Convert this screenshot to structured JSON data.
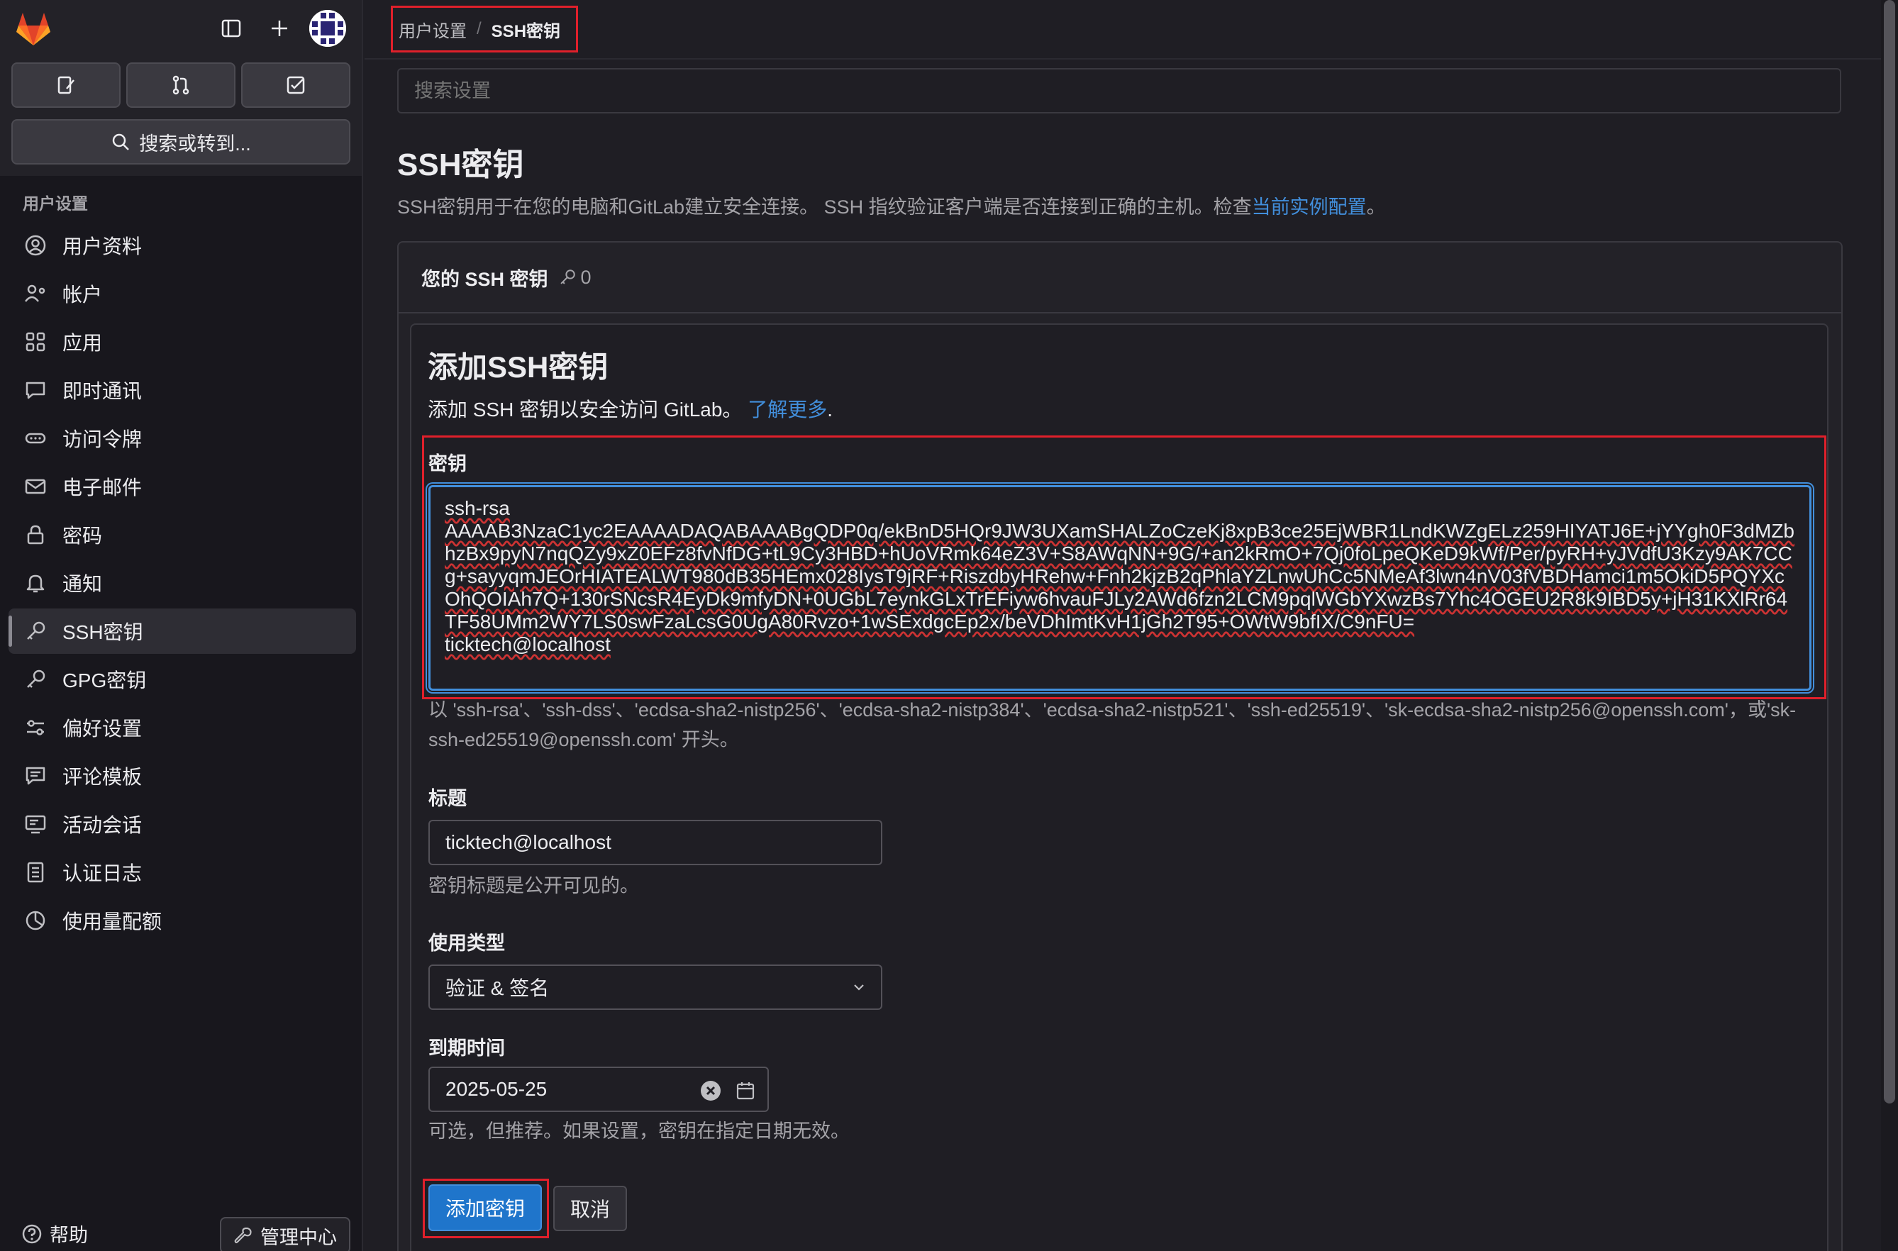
{
  "sidebar": {
    "search_label": "搜索或转到...",
    "section_title": "用户设置",
    "items": [
      {
        "label": "用户资料",
        "icon": "user-icon"
      },
      {
        "label": "帐户",
        "icon": "account-icon"
      },
      {
        "label": "应用",
        "icon": "apps-icon"
      },
      {
        "label": "即时通讯",
        "icon": "chat-icon"
      },
      {
        "label": "访问令牌",
        "icon": "token-icon"
      },
      {
        "label": "电子邮件",
        "icon": "mail-icon"
      },
      {
        "label": "密码",
        "icon": "lock-icon"
      },
      {
        "label": "通知",
        "icon": "bell-icon"
      },
      {
        "label": "SSH密钥",
        "icon": "key-icon",
        "active": true
      },
      {
        "label": "GPG密钥",
        "icon": "key-icon"
      },
      {
        "label": "偏好设置",
        "icon": "preferences-icon"
      },
      {
        "label": "评论模板",
        "icon": "comment-template-icon"
      },
      {
        "label": "活动会话",
        "icon": "monitor-icon"
      },
      {
        "label": "认证日志",
        "icon": "log-icon"
      },
      {
        "label": "使用量配额",
        "icon": "quota-icon"
      }
    ],
    "help_label": "帮助",
    "admin_label": "管理中心"
  },
  "breadcrumb": {
    "parent": "用户设置",
    "separator": "/",
    "current": "SSH密钥"
  },
  "search": {
    "placeholder": "搜索设置"
  },
  "page": {
    "title": "SSH密钥",
    "description": "SSH密钥用于在您的电脑和GitLab建立安全连接。 SSH 指纹验证客户端是否连接到正确的主机。检查",
    "description_link": "当前实例配置",
    "description_end": "。"
  },
  "keys_card": {
    "title": "您的 SSH 密钥",
    "count": "0"
  },
  "form": {
    "title": "添加SSH密钥",
    "description": "添加 SSH 密钥以安全访问 GitLab。",
    "learn_more": "了解更多",
    "learn_more_end": ".",
    "key_label": "密钥",
    "key_value": "ssh-rsa\nAAAAB3NzaC1yc2EAAAADAQABAAABgQDP0q/ekBnD5HQr9JW3UXamSHALZoCzeKj8xpB3ce25EjWBR1LndKWZgELz259HIYATJ6E+jYYgh0F3dMZbhzBx9pyN7nqQZy9xZ0EFz8fvNfDG+tL9Cy3HBD+hUoVRmk64eZ3V+S8AWqNN+9G/+an2kRmO+7Qj0foLpeQKeD9kWf/Per/pyRH+yJVdfU3Kzy9AK7CCg+sayyqmJEOrHIATEALWT980dB35HEmx028IysT9jRF+RiszdbyHRehw+Fnh2kjzB2qPhlaYZLnwUhCc5NMeAf3lwn4nV03fVBDHamci1m5OkiD5PQYXcOhQOIAh7Q+130rSNcsR4EyDk9mfyDN+0UGbL7eynkGLxTrEFiyw6hvauFJLy2AWd6fzn2LCM9pqlWGbYXwzBs7Yhc4OGEU2R8k9IBD5y+jH31KXlRr64TF58UMm2WY7LS0swFzaLcsG0UgA80Rvzo+1wSExdgcEp2x/beVDhImtKvH1jGh2T95+OWtW9bfIX/C9nFU=\nticktech@localhost",
    "key_help": "以 'ssh-rsa'、'ssh-dss'、'ecdsa-sha2-nistp256'、'ecdsa-sha2-nistp384'、'ecdsa-sha2-nistp521'、'ssh-ed25519'、'sk-ecdsa-sha2-nistp256@openssh.com'，或'sk-ssh-ed25519@openssh.com' 开头。",
    "title_label": "标题",
    "title_value": "ticktech@localhost",
    "title_help": "密钥标题是公开可见的。",
    "usage_label": "使用类型",
    "usage_value": "验证 & 签名",
    "expiry_label": "到期时间",
    "expiry_value": "2025-05-25",
    "expiry_help": "可选，但推荐。如果设置，密钥在指定日期无效。",
    "submit_label": "添加密钥",
    "cancel_label": "取消"
  },
  "colors": {
    "highlight": "#e0202b",
    "link": "#428fdc",
    "primary_button": "#1f75cb"
  }
}
